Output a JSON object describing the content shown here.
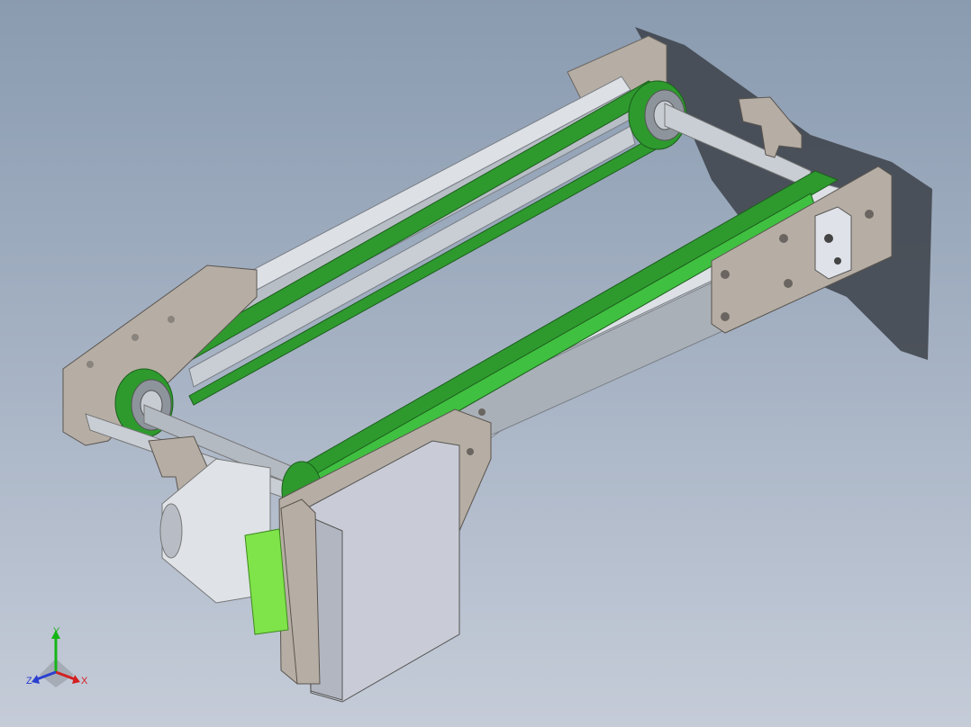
{
  "viewport": {
    "background_top": "#8a9bb0",
    "background_bottom": "#c5ccd8"
  },
  "model": {
    "belt_color": "#2e9a2e",
    "belt_highlight": "#40c040",
    "plate_color": "#b6aea4",
    "rail_color": "#d9dde3",
    "motor_box_color": "#c9ccd6",
    "motor_accent": "#7fe34a"
  },
  "triad": {
    "y_label": "Y",
    "x_label": "X",
    "z_label": "Z",
    "y_color": "#16b516",
    "x_color": "#d32020",
    "z_color": "#2a3fd0"
  }
}
